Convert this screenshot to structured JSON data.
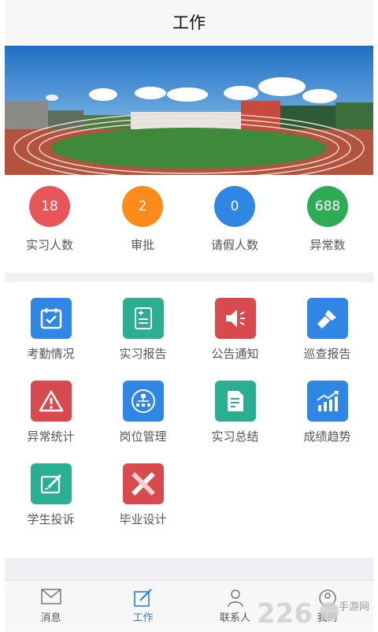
{
  "header": {
    "title": "工作"
  },
  "colors": {
    "red": "#e8565a",
    "orange": "#fb8c1c",
    "blue": "#2f86e4",
    "green": "#2eab55",
    "teal": "#2aaf92",
    "accent": "#2a7fd4"
  },
  "stats": [
    {
      "value": "18",
      "label": "实习人数",
      "color": "#e8565a"
    },
    {
      "value": "2",
      "label": "审批",
      "color": "#fb8c1c"
    },
    {
      "value": "0",
      "label": "请假人数",
      "color": "#2f86e4"
    },
    {
      "value": "688",
      "label": "异常数",
      "color": "#2eab55"
    }
  ],
  "grid": [
    {
      "label": "考勤情况",
      "icon": "calendar-check-icon",
      "color": "#2f86e4"
    },
    {
      "label": "实习报告",
      "icon": "document-plus-icon",
      "color": "#2aaf92"
    },
    {
      "label": "公告通知",
      "icon": "megaphone-icon",
      "color": "#d94a4f"
    },
    {
      "label": "巡查报告",
      "icon": "flashlight-icon",
      "color": "#2f86e4"
    },
    {
      "label": "异常统计",
      "icon": "warning-icon",
      "color": "#d94a4f"
    },
    {
      "label": "岗位管理",
      "icon": "org-chart-icon",
      "color": "#2f86e4"
    },
    {
      "label": "实习总结",
      "icon": "document-edit-icon",
      "color": "#2aaf92"
    },
    {
      "label": "成绩趋势",
      "icon": "chart-trend-icon",
      "color": "#2f86e4"
    },
    {
      "label": "学生投诉",
      "icon": "note-edit-icon",
      "color": "#2aaf92"
    },
    {
      "label": "毕业设计",
      "icon": "ruler-pencil-icon",
      "color": "#d94a4f"
    }
  ],
  "tabbar": [
    {
      "label": "消息",
      "icon": "mail-icon",
      "active": false
    },
    {
      "label": "工作",
      "icon": "edit-icon",
      "active": true
    },
    {
      "label": "联系人",
      "icon": "person-icon",
      "active": false
    },
    {
      "label": "我的",
      "icon": "profile-icon",
      "active": false
    }
  ],
  "watermark": {
    "text": "226",
    "subtext": "手游网"
  }
}
